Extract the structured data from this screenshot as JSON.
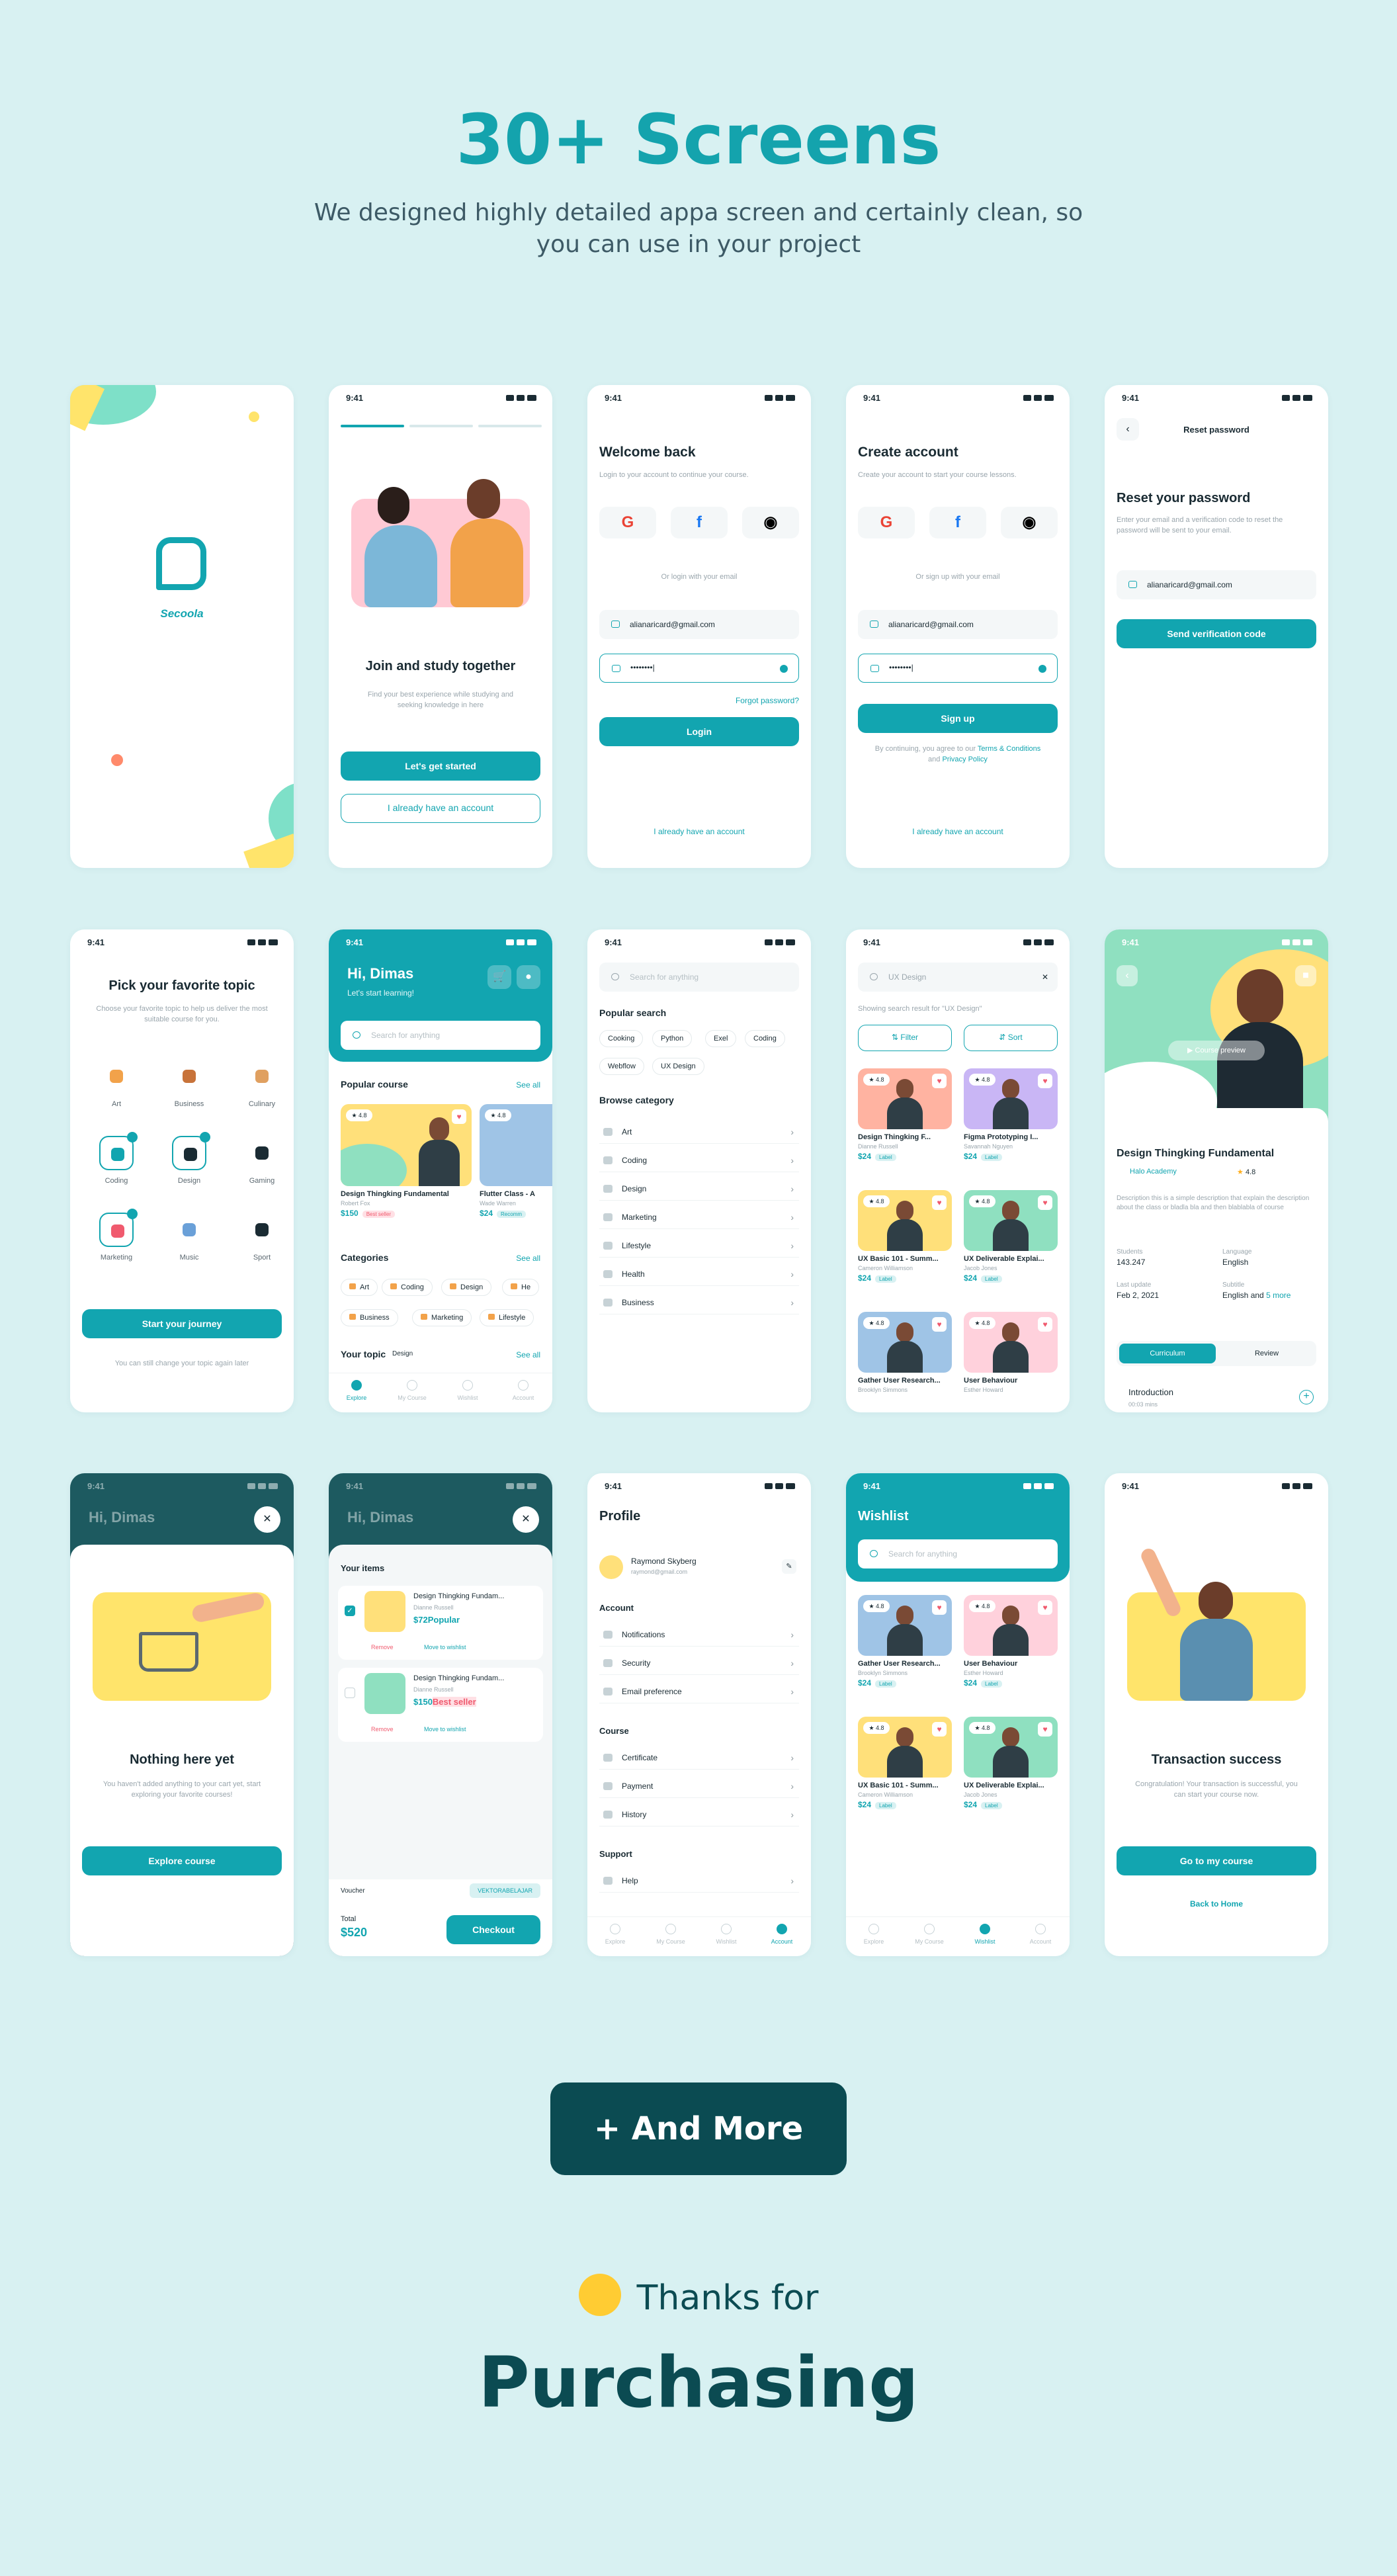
{
  "hero": {
    "title": "30+ Screens",
    "subtitle": "We designed highly detailed appa screen and certainly clean, so you can use in your project"
  },
  "status_time": "9:41",
  "splash": {
    "brand": "Secoola"
  },
  "onboarding": {
    "title": "Join and study together",
    "subtitle": "Find your best experience while studying and seeking knowledge in here",
    "primary": "Let's get started",
    "secondary": "I already have an account"
  },
  "login": {
    "title": "Welcome back",
    "subtitle": "Login to your account to continue your course.",
    "divider": "Or login with your email",
    "email": "alianaricard@gmail.com",
    "password": "••••••••|",
    "forgot": "Forgot password?",
    "button": "Login",
    "footer": "I already have an account"
  },
  "signup": {
    "title": "Create account",
    "subtitle": "Create your account to start your course lessons.",
    "divider": "Or sign up with your email",
    "email": "alianaricard@gmail.com",
    "password": "••••••••|",
    "button": "Sign up",
    "terms_prefix": "By continuing, you agree to our",
    "terms_link": "Terms & Conditions",
    "terms_and": "and",
    "privacy_link": "Privacy Policy",
    "footer": "I already have an account"
  },
  "reset": {
    "header": "Reset password",
    "title": "Reset your password",
    "subtitle": "Enter your email and a verification code to reset the password will be sent to your email.",
    "email": "alianaricard@gmail.com",
    "button": "Send verification code"
  },
  "topics": {
    "title": "Pick your favorite topic",
    "subtitle": "Choose your favorite topic to help us deliver the most suitable course for you.",
    "items": [
      "Art",
      "Business",
      "Culinary",
      "Coding",
      "Design",
      "Gaming",
      "Marketing",
      "Music",
      "Sport"
    ],
    "button": "Start your journey",
    "footer": "You can still change your topic again later"
  },
  "home": {
    "greeting": "Hi, Dimas",
    "sub": "Let's start learning!",
    "search": "Search for anything",
    "popular": "Popular course",
    "see_all": "See all",
    "course1": {
      "rating": "4.8",
      "title": "Design Thingking Fundamental",
      "author": "Robert Fox",
      "price": "$150",
      "badge": "Best seller"
    },
    "course2": {
      "rating": "4.8",
      "title": "Flutter Class - A",
      "author": "Wade Warren",
      "price": "$24",
      "badge": "Recomm"
    },
    "categories": "Categories",
    "cats": [
      "Art",
      "Coding",
      "Design",
      "He",
      "Business",
      "Marketing",
      "Lifestyle"
    ],
    "your_topic": "Your topic",
    "topic_badge": "Design",
    "tabs": [
      "Explore",
      "My Course",
      "Wishlist",
      "Account"
    ]
  },
  "search_screen": {
    "placeholder": "Search for anything",
    "popular": "Popular search",
    "chips": [
      "Cooking",
      "Python",
      "Exel",
      "Coding",
      "Webflow",
      "UX Design"
    ],
    "browse": "Browse category",
    "rows": [
      "Art",
      "Coding",
      "Design",
      "Marketing",
      "Lifestyle",
      "Health",
      "Business"
    ]
  },
  "results": {
    "query": "UX Design",
    "showing": "Showing search result for \"UX Design\"",
    "filter": "Filter",
    "sort": "Sort",
    "cards": [
      {
        "rating": "4.8",
        "title": "Design Thingking F...",
        "author": "Dianne Russell",
        "price": "$24",
        "label": "Label",
        "bg": "#ffb3a1"
      },
      {
        "rating": "4.8",
        "title": "Figma Prototyping I...",
        "author": "Savannah Nguyen",
        "price": "$24",
        "label": "Label",
        "bg": "#c9b6f5"
      },
      {
        "rating": "4.8",
        "title": "UX Basic 101 - Summ...",
        "author": "Cameron Williamson",
        "price": "$24",
        "label": "Label",
        "bg": "#ffe07a"
      },
      {
        "rating": "4.8",
        "title": "UX Deliverable Explai...",
        "author": "Jacob Jones",
        "price": "$24",
        "label": "Label",
        "bg": "#8fe0c0"
      },
      {
        "rating": "4.8",
        "title": "Gather User Research...",
        "author": "Brooklyn Simmons",
        "price": "",
        "label": "",
        "bg": "#9fc4e6"
      },
      {
        "rating": "4.8",
        "title": "User Behaviour",
        "author": "Esther Howard",
        "price": "",
        "label": "",
        "bg": "#ffd1dc"
      }
    ]
  },
  "detail": {
    "preview": "Course preview",
    "title": "Design Thingking Fundamental",
    "academy": "Halo Academy",
    "rating": "4.8",
    "desc": "Description this is a simple description that explain the description about the class or bladla bla and then blablabla of course",
    "students_l": "Students",
    "students_v": "143.247",
    "language_l": "Language",
    "language_v": "English",
    "update_l": "Last update",
    "update_v": "Feb 2, 2021",
    "subtitle_l": "Subtitle",
    "subtitle_v": "English and",
    "subtitle_more": "5 more",
    "tab1": "Curriculum",
    "tab2": "Review",
    "section": "Introduction",
    "section_time": "00:03 mins"
  },
  "empty_cart": {
    "title": "Nothing here yet",
    "subtitle": "You haven't added anything to your cart yet, start exploring your favorite courses!",
    "button": "Explore course"
  },
  "cart": {
    "title": "Your items",
    "item1": {
      "name": "Design Thingking Fundam...",
      "author": "Dianne Russell",
      "price": "$72",
      "badge": "Popular",
      "remove": "Remove",
      "move": "Move to wishlist"
    },
    "item2": {
      "name": "Design Thingking Fundam...",
      "author": "Dianne Russell",
      "price": "$150",
      "badge": "Best seller",
      "remove": "Remove",
      "move": "Move to wishlist"
    },
    "voucher_l": "Voucher",
    "voucher_v": "VEKTORABELAJAR",
    "total_l": "Total",
    "total_v": "$520",
    "checkout": "Checkout"
  },
  "profile": {
    "title": "Profile",
    "name": "Raymond Skyberg",
    "email": "raymond@gmail.com",
    "account": "Account",
    "account_rows": [
      "Notifications",
      "Security",
      "Email preference"
    ],
    "course": "Course",
    "course_rows": [
      "Certificate",
      "Payment",
      "History"
    ],
    "support": "Support",
    "support_rows": [
      "Help"
    ]
  },
  "wishlist": {
    "title": "Wishlist",
    "search": "Search for anything",
    "cards": [
      {
        "rating": "4.8",
        "title": "Gather User Research...",
        "author": "Brooklyn Simmons",
        "price": "$24",
        "label": "Label",
        "bg": "#9fc4e6"
      },
      {
        "rating": "4.8",
        "title": "User Behaviour",
        "author": "Esther Howard",
        "price": "$24",
        "label": "Label",
        "bg": "#ffd1dc"
      },
      {
        "rating": "4.8",
        "title": "UX Basic 101 - Summ...",
        "author": "Cameron Williamson",
        "price": "$24",
        "label": "Label",
        "bg": "#ffe07a"
      },
      {
        "rating": "4.8",
        "title": "UX Deliverable Explai...",
        "author": "Jacob Jones",
        "price": "$24",
        "label": "Label",
        "bg": "#8fe0c0"
      }
    ]
  },
  "success": {
    "title": "Transaction success",
    "subtitle": "Congratulation! Your transaction is successful, you can start your course now.",
    "button": "Go to my course",
    "link": "Back to Home"
  },
  "more": "+ And More",
  "thanks": "Thanks for",
  "purchasing": "Purchasing",
  "colors": {
    "accent": "#12a5b0",
    "page_bg": "#d8f1f2",
    "dark": "#0b4b52"
  }
}
